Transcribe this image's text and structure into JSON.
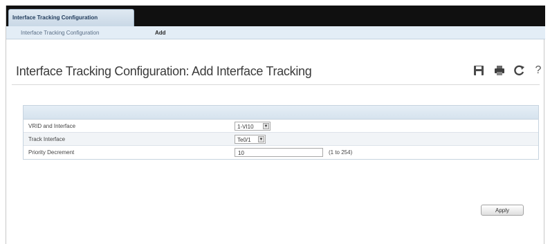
{
  "top_tab": {
    "label": "Interface Tracking Configuration"
  },
  "subnav": {
    "items": [
      {
        "label": "Interface Tracking Configuration"
      },
      {
        "label": "Add"
      }
    ]
  },
  "page": {
    "title": "Interface Tracking Configuration: Add Interface Tracking"
  },
  "toolbar": {
    "icons": [
      "save-icon",
      "print-icon",
      "refresh-icon",
      "help-icon"
    ],
    "help_glyph": "?"
  },
  "form": {
    "rows": [
      {
        "label": "VRID and Interface",
        "value": "1-VI10",
        "control": "select"
      },
      {
        "label": "Track Interface",
        "value": "Te0/1",
        "control": "select"
      },
      {
        "label": "Priority Decrement",
        "value": "10",
        "control": "text",
        "hint": "(1 to 254)"
      }
    ]
  },
  "actions": {
    "apply_label": "Apply"
  },
  "colors": {
    "top_bar": "#101010",
    "subnav_bg": "#e3edf6",
    "panel_header": "#d6e3ee"
  }
}
